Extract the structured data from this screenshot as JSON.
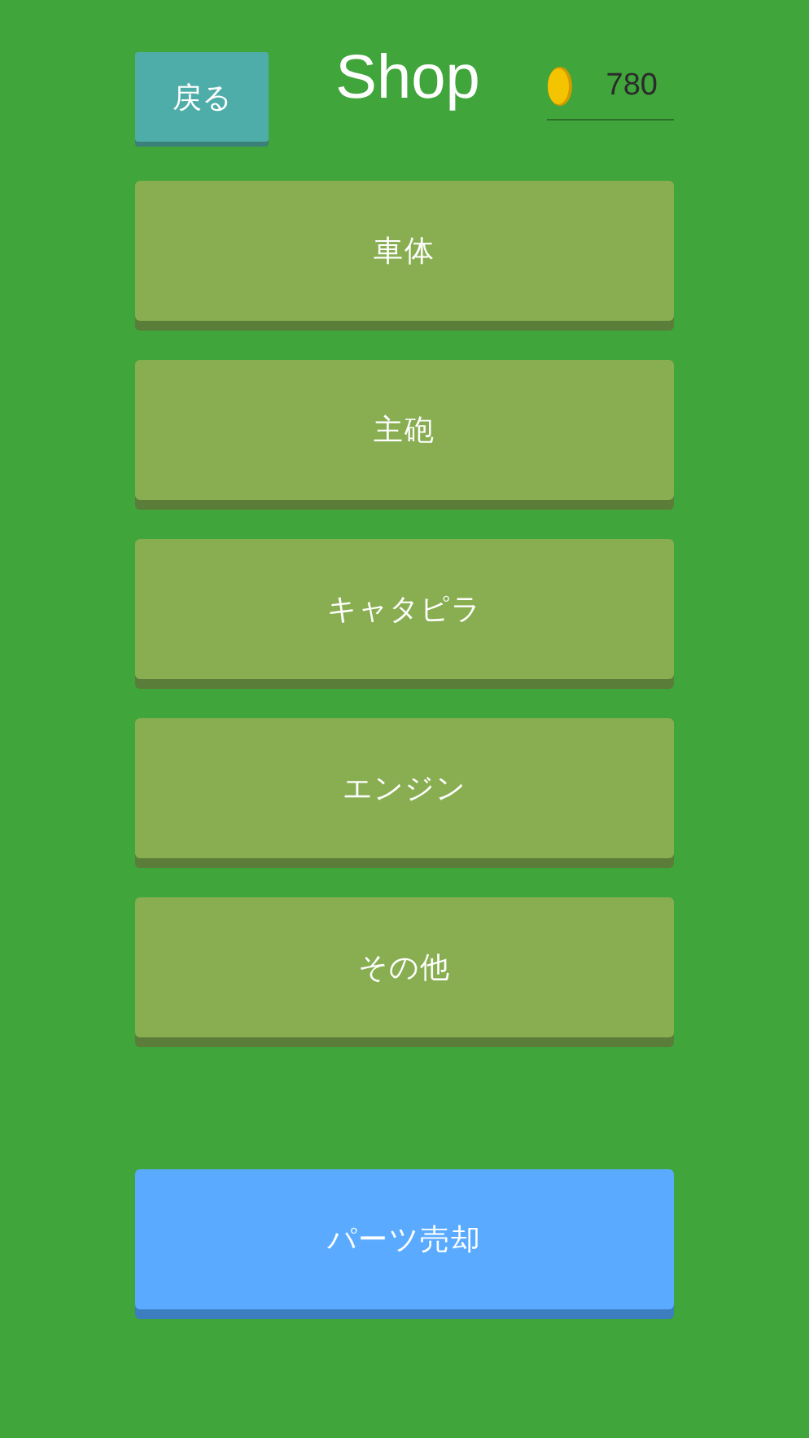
{
  "header": {
    "back_button": "戻る",
    "title": "Shop",
    "coins": "780"
  },
  "menu": [
    {
      "label": "車体",
      "kind": "category"
    },
    {
      "label": "主砲",
      "kind": "category"
    },
    {
      "label": "キャタピラ",
      "kind": "category"
    },
    {
      "label": "エンジン",
      "kind": "category"
    },
    {
      "label": "その他",
      "kind": "category"
    },
    {
      "label": "パーツ売却",
      "kind": "sell"
    }
  ]
}
